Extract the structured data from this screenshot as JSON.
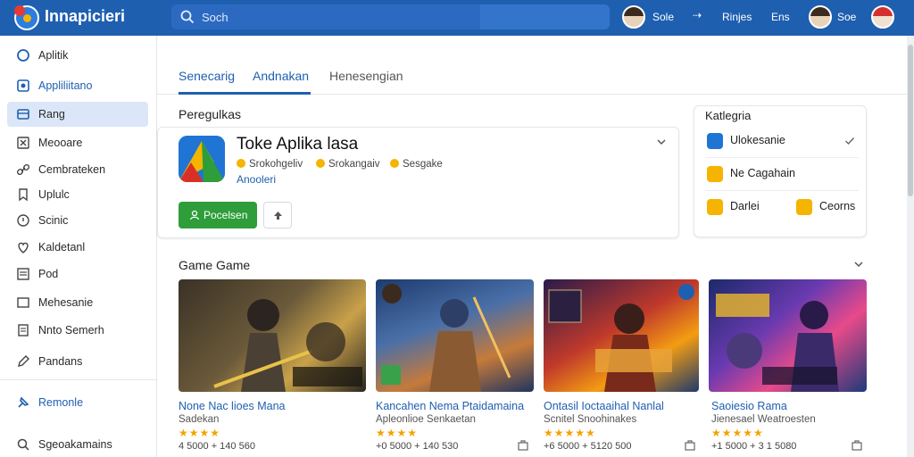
{
  "header": {
    "app_title": "Innapicieri",
    "search_placeholder": "Soch",
    "links": [
      "Sole",
      "Rinjes",
      "Ens",
      "Soe"
    ],
    "accent": "#1f5fb0"
  },
  "sidebar": {
    "items": [
      {
        "label": "Aplitik",
        "icon": "circle-icon"
      },
      {
        "label": "Appliliitano",
        "icon": "app-icon"
      },
      {
        "label": "Rang",
        "icon": "grid-icon"
      },
      {
        "label": "Meooare",
        "icon": "close-box-icon"
      },
      {
        "label": "Cembrateken",
        "icon": "link-icon"
      },
      {
        "label": "Uplulc",
        "icon": "tag-icon"
      },
      {
        "label": "Scinic",
        "icon": "shield-icon"
      },
      {
        "label": "Kaldetanl",
        "icon": "heart-icon"
      },
      {
        "label": "Pod",
        "icon": "list-icon"
      },
      {
        "label": "Mehesanie",
        "icon": "tablet-icon"
      },
      {
        "label": "Nnto Semerh",
        "icon": "doc-icon"
      },
      {
        "label": "Pandans",
        "icon": "pen-icon"
      },
      {
        "label": "Remonle",
        "icon": "pin-icon"
      },
      {
        "label": "Sgeoakamains",
        "icon": "search-icon"
      }
    ]
  },
  "tabs": [
    "Senecarig",
    "Andnakan",
    "Henesengian"
  ],
  "featured": {
    "section_title": "Peregulkas",
    "app_name": "Toke Aplika lasa",
    "meta": [
      "Srokohgeliv",
      "Srokangaiv",
      "Sesgake"
    ],
    "developer": "Anooleri",
    "install_label": "Pocelsen"
  },
  "categories": {
    "title": "Katlegria",
    "items": [
      "Ulokesanie",
      "Ne Cagahain",
      "Darlei",
      "Ceorns"
    ]
  },
  "games": {
    "section_title": "Game Game",
    "items": [
      {
        "title": "None Nac lioes Mana",
        "developer": "Sadekan",
        "stars": "★★★★",
        "count": "4 5000 + 140 560"
      },
      {
        "title": "Kancahen Nema Ptaidamaina",
        "developer": "Apleonlioe Senkaetan",
        "stars": "★★★★",
        "count": "+0 5000 + 140 530"
      },
      {
        "title": "Ontasil Ioctaaihal Nanlal",
        "developer": "Scnitel Snoohinakes",
        "stars": "★★★★★",
        "count": "+6 5000 + 5120 500"
      },
      {
        "title": "Saoiesio Rama",
        "developer": "Jienesael Weatroesten",
        "stars": "★★★★★",
        "count": "+1 5000 + 3 1 5080"
      }
    ]
  }
}
